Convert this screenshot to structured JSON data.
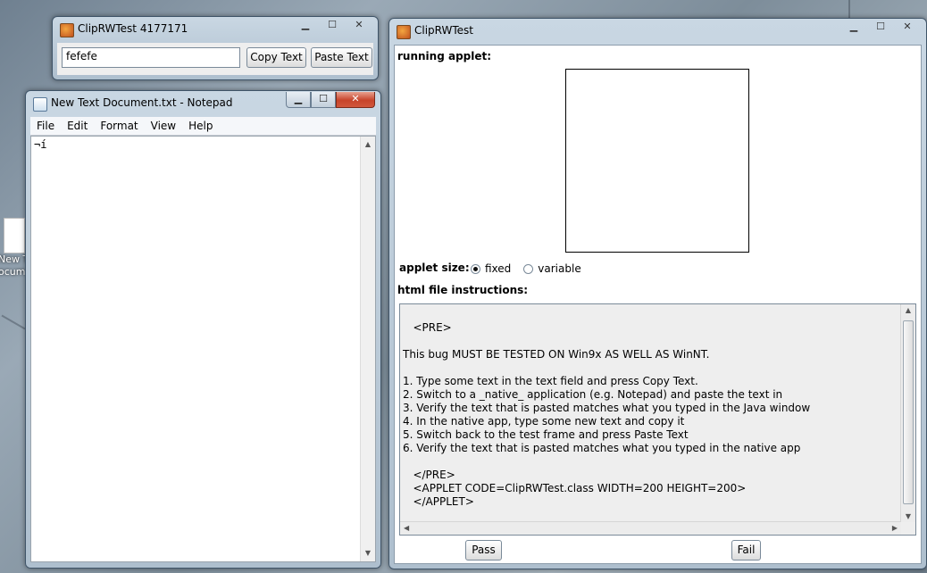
{
  "desktop": {
    "icon_label_line1": "New T",
    "icon_label_line2": "ocume"
  },
  "small_window": {
    "title": "ClipRWTest 4177171",
    "text_field_value": "fefefe",
    "copy_button": "Copy Text",
    "paste_button": "Paste Text"
  },
  "notepad": {
    "title": "New Text Document.txt - Notepad",
    "menu": [
      "File",
      "Edit",
      "Format",
      "View",
      "Help"
    ],
    "content": "¬í"
  },
  "main_window": {
    "title": "ClipRWTest",
    "running_label": "running applet:",
    "size_label": "applet size:",
    "radio_fixed": "fixed",
    "radio_variable": "variable",
    "instructions_label": "html file instructions:",
    "instructions": [
      "",
      "   <PRE>",
      "",
      "This bug MUST BE TESTED ON Win9x AS WELL AS WinNT.",
      "",
      "1. Type some text in the text field and press Copy Text.",
      "2. Switch to a _native_ application (e.g. Notepad) and paste the text in",
      "3. Verify the text that is pasted matches what you typed in the Java window",
      "4. In the native app, type some new text and copy it",
      "5. Switch back to the test frame and press Paste Text",
      "6. Verify the text that is pasted matches what you typed in the native app",
      "",
      "   </PRE>",
      "   <APPLET CODE=ClipRWTest.class WIDTH=200 HEIGHT=200>",
      "   </APPLET>"
    ],
    "pass_button": "Pass",
    "fail_button": "Fail"
  },
  "captions": {
    "minimize": "▁",
    "maximize": "☐",
    "close": "✕"
  }
}
